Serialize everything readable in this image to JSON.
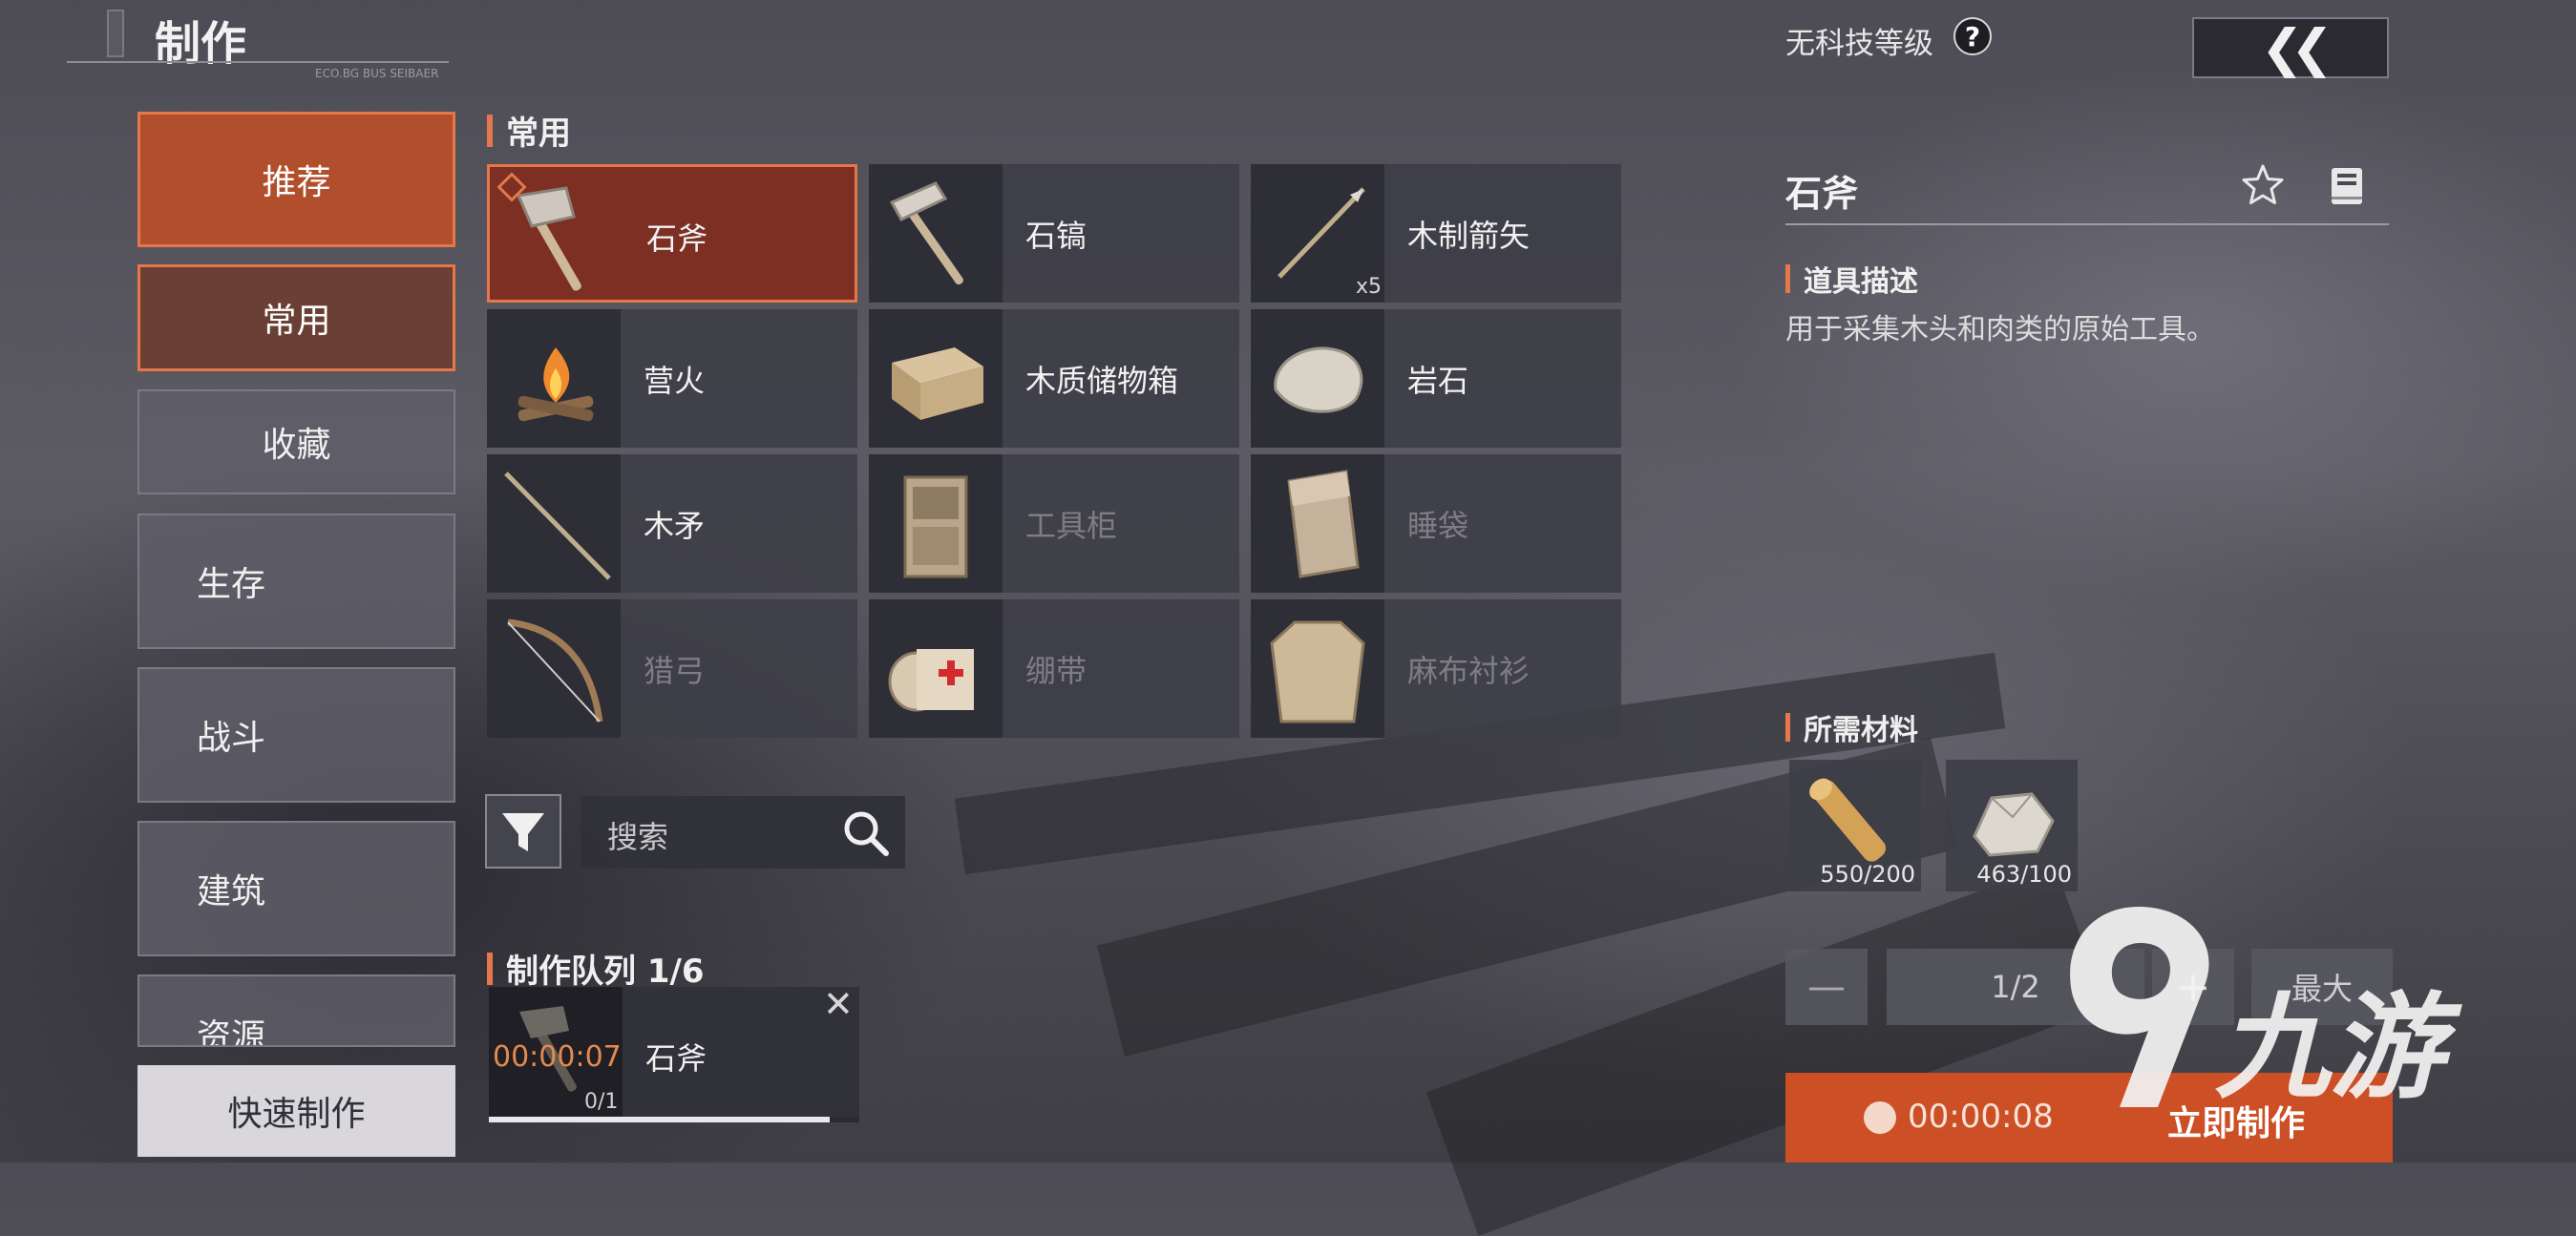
{
  "header": {
    "title": "制作",
    "subtitle_small": "ECO.BG BUS SEIBAER"
  },
  "nav": {
    "recommend": "推荐",
    "common": "常用",
    "favorites": "收藏",
    "survival": "生存",
    "combat": "战斗",
    "building": "建筑",
    "resources": "资源",
    "quick_craft": "快速制作"
  },
  "grid": {
    "section_title": "常用",
    "items": [
      {
        "name": "石斧",
        "state": "selected",
        "icon": "stone-axe-icon"
      },
      {
        "name": "石镐",
        "state": "available",
        "icon": "stone-pickaxe-icon"
      },
      {
        "name": "木制箭矢",
        "state": "available",
        "icon": "wooden-arrow-icon",
        "badge": "x5"
      },
      {
        "name": "营火",
        "state": "available",
        "icon": "campfire-icon"
      },
      {
        "name": "木质储物箱",
        "state": "available",
        "icon": "wooden-storage-box-icon"
      },
      {
        "name": "岩石",
        "state": "available",
        "icon": "rock-icon"
      },
      {
        "name": "木矛",
        "state": "available",
        "icon": "wooden-spear-icon"
      },
      {
        "name": "工具柜",
        "state": "locked",
        "icon": "tool-cupboard-icon"
      },
      {
        "name": "睡袋",
        "state": "locked",
        "icon": "sleeping-bag-icon"
      },
      {
        "name": "猎弓",
        "state": "locked",
        "icon": "hunting-bow-icon"
      },
      {
        "name": "绷带",
        "state": "locked",
        "icon": "bandage-icon"
      },
      {
        "name": "麻布衬衫",
        "state": "locked",
        "icon": "burlap-shirt-icon"
      }
    ]
  },
  "search": {
    "placeholder": "搜索"
  },
  "queue": {
    "title": "制作队列 1/6",
    "item": {
      "time": "00:00:07",
      "name": "石斧",
      "count": "0/1",
      "progress": 0.92
    }
  },
  "detail": {
    "tech_level": "无科技等级",
    "help": "?",
    "back": "«",
    "item_name": "石斧",
    "desc_title": "道具描述",
    "description": "用于采集木头和肉类的原始工具。",
    "materials_title": "所需材料",
    "materials": [
      {
        "icon": "wood-log-icon",
        "count": "550/200"
      },
      {
        "icon": "stone-pile-icon",
        "count": "463/100"
      }
    ],
    "quantity": {
      "minus": "—",
      "value": "1/2",
      "plus": "+",
      "max": "最大"
    },
    "craft_time": "00:00:08",
    "craft_now": "立即制作"
  },
  "watermark": "九游",
  "colors": {
    "accent": "#e5784a",
    "craft_button": "#cc4f26",
    "selected_bg": "#7c2f22"
  }
}
